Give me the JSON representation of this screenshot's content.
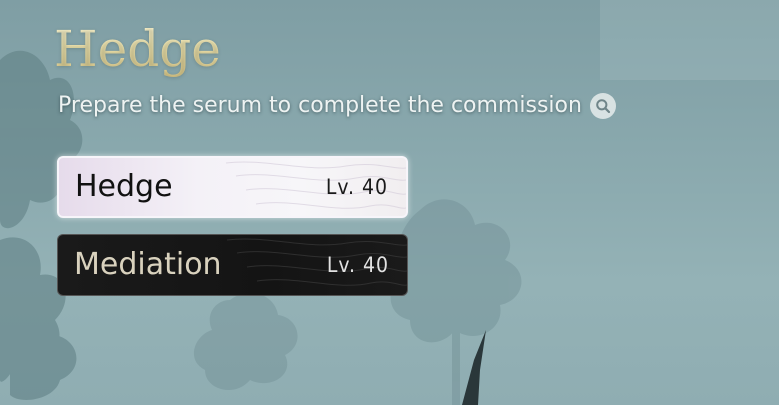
{
  "quest": {
    "title": "Hedge",
    "description": "Prepare the serum to complete the commission",
    "info_icon": "search-icon"
  },
  "options": [
    {
      "label": "Hedge",
      "level": "Lv. 40",
      "selected": true
    },
    {
      "label": "Mediation",
      "level": "Lv. 40",
      "selected": false
    }
  ],
  "colors": {
    "title_gold": "#f6e9b2",
    "selected_bg": "#f4f1f7",
    "default_bg": "#141414",
    "default_label": "#d9d2be"
  }
}
